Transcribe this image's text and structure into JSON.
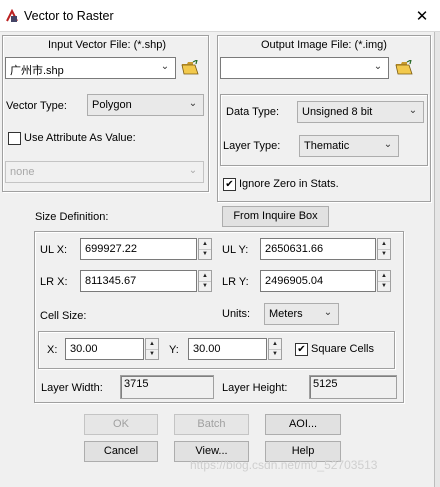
{
  "window": {
    "title": "Vector to Raster",
    "close_glyph": "✕"
  },
  "input": {
    "label": "Input Vector File: (*.shp)",
    "file_value": "广州市.shp",
    "vector_type_label": "Vector Type:",
    "vector_type_value": "Polygon",
    "use_attribute_label": "Use Attribute As Value:",
    "use_attribute_checked": false,
    "attribute_value": "none"
  },
  "output": {
    "label": "Output Image File: (*.img)",
    "file_value": "",
    "data_type_label": "Data Type:",
    "data_type_value": "Unsigned 8 bit",
    "layer_type_label": "Layer Type:",
    "layer_type_value": "Thematic",
    "ignore_zero_label": "Ignore Zero in Stats.",
    "ignore_zero_checked": true
  },
  "size": {
    "label": "Size Definition:",
    "from_inquire_box": "From Inquire Box",
    "ulx_label": "UL X:",
    "ulx_value": "699927.22",
    "uly_label": "UL Y:",
    "uly_value": "2650631.66",
    "lrx_label": "LR X:",
    "lrx_value": "811345.67",
    "lry_label": "LR Y:",
    "lry_value": "2496905.04",
    "cell_size_label": "Cell Size:",
    "units_label": "Units:",
    "units_value": "Meters",
    "x_label": "X:",
    "x_value": "30.00",
    "y_label": "Y:",
    "y_value": "30.00",
    "square_cells_label": "Square Cells",
    "square_cells_checked": true,
    "layer_width_label": "Layer Width:",
    "layer_width_value": "3715",
    "layer_height_label": "Layer Height:",
    "layer_height_value": "5125"
  },
  "buttons": {
    "ok": "OK",
    "batch": "Batch",
    "aoi": "AOI...",
    "cancel": "Cancel",
    "view": "View...",
    "help": "Help"
  },
  "watermark": "https://blog.csdn.net/m0_52703513"
}
